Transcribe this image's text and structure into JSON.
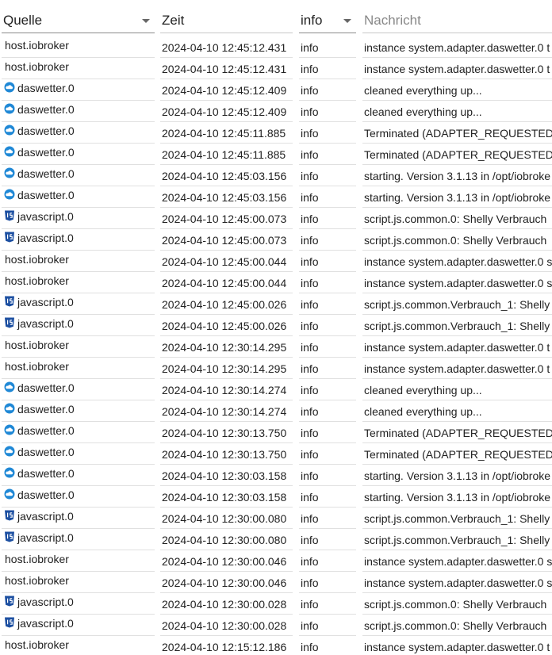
{
  "header": {
    "columns": [
      {
        "label": "Quelle"
      },
      {
        "label": "Zeit"
      },
      {
        "label": "info"
      },
      {
        "label": "Nachricht"
      }
    ]
  },
  "icons": {
    "daswetter": "daswetter-adapter-icon",
    "javascript": "javascript-adapter-icon"
  },
  "colors": {
    "daswetter_icon": "#1f88d6",
    "javascript_icon": "#1c4fa1",
    "row_border": "#e0e0e0",
    "header_border": "#8a8a8a"
  },
  "rows": [
    {
      "type": "host",
      "source": "host.iobroker",
      "time": "2024-04-10 12:45:12.431",
      "level": "info",
      "message": "instance system.adapter.daswetter.0 t"
    },
    {
      "type": "host",
      "source": "host.iobroker",
      "time": "2024-04-10 12:45:12.431",
      "level": "info",
      "message": "instance system.adapter.daswetter.0 t"
    },
    {
      "type": "daswetter",
      "source": "daswetter.0",
      "time": "2024-04-10 12:45:12.409",
      "level": "info",
      "message": "cleaned everything up..."
    },
    {
      "type": "daswetter",
      "source": "daswetter.0",
      "time": "2024-04-10 12:45:12.409",
      "level": "info",
      "message": "cleaned everything up..."
    },
    {
      "type": "daswetter",
      "source": "daswetter.0",
      "time": "2024-04-10 12:45:11.885",
      "level": "info",
      "message": "Terminated (ADAPTER_REQUESTED"
    },
    {
      "type": "daswetter",
      "source": "daswetter.0",
      "time": "2024-04-10 12:45:11.885",
      "level": "info",
      "message": "Terminated (ADAPTER_REQUESTED"
    },
    {
      "type": "daswetter",
      "source": "daswetter.0",
      "time": "2024-04-10 12:45:03.156",
      "level": "info",
      "message": "starting. Version 3.1.13 in /opt/iobroke"
    },
    {
      "type": "daswetter",
      "source": "daswetter.0",
      "time": "2024-04-10 12:45:03.156",
      "level": "info",
      "message": "starting. Version 3.1.13 in /opt/iobroke"
    },
    {
      "type": "javascript",
      "source": "javascript.0",
      "time": "2024-04-10 12:45:00.073",
      "level": "info",
      "message": "script.js.common.0: Shelly Verbrauch"
    },
    {
      "type": "javascript",
      "source": "javascript.0",
      "time": "2024-04-10 12:45:00.073",
      "level": "info",
      "message": "script.js.common.0: Shelly Verbrauch"
    },
    {
      "type": "host",
      "source": "host.iobroker",
      "time": "2024-04-10 12:45:00.044",
      "level": "info",
      "message": "instance system.adapter.daswetter.0 s"
    },
    {
      "type": "host",
      "source": "host.iobroker",
      "time": "2024-04-10 12:45:00.044",
      "level": "info",
      "message": "instance system.adapter.daswetter.0 s"
    },
    {
      "type": "javascript",
      "source": "javascript.0",
      "time": "2024-04-10 12:45:00.026",
      "level": "info",
      "message": "script.js.common.Verbrauch_1: Shelly"
    },
    {
      "type": "javascript",
      "source": "javascript.0",
      "time": "2024-04-10 12:45:00.026",
      "level": "info",
      "message": "script.js.common.Verbrauch_1: Shelly"
    },
    {
      "type": "host",
      "source": "host.iobroker",
      "time": "2024-04-10 12:30:14.295",
      "level": "info",
      "message": "instance system.adapter.daswetter.0 t"
    },
    {
      "type": "host",
      "source": "host.iobroker",
      "time": "2024-04-10 12:30:14.295",
      "level": "info",
      "message": "instance system.adapter.daswetter.0 t"
    },
    {
      "type": "daswetter",
      "source": "daswetter.0",
      "time": "2024-04-10 12:30:14.274",
      "level": "info",
      "message": "cleaned everything up..."
    },
    {
      "type": "daswetter",
      "source": "daswetter.0",
      "time": "2024-04-10 12:30:14.274",
      "level": "info",
      "message": "cleaned everything up..."
    },
    {
      "type": "daswetter",
      "source": "daswetter.0",
      "time": "2024-04-10 12:30:13.750",
      "level": "info",
      "message": "Terminated (ADAPTER_REQUESTED"
    },
    {
      "type": "daswetter",
      "source": "daswetter.0",
      "time": "2024-04-10 12:30:13.750",
      "level": "info",
      "message": "Terminated (ADAPTER_REQUESTED"
    },
    {
      "type": "daswetter",
      "source": "daswetter.0",
      "time": "2024-04-10 12:30:03.158",
      "level": "info",
      "message": "starting. Version 3.1.13 in /opt/iobroke"
    },
    {
      "type": "daswetter",
      "source": "daswetter.0",
      "time": "2024-04-10 12:30:03.158",
      "level": "info",
      "message": "starting. Version 3.1.13 in /opt/iobroke"
    },
    {
      "type": "javascript",
      "source": "javascript.0",
      "time": "2024-04-10 12:30:00.080",
      "level": "info",
      "message": "script.js.common.Verbrauch_1: Shelly"
    },
    {
      "type": "javascript",
      "source": "javascript.0",
      "time": "2024-04-10 12:30:00.080",
      "level": "info",
      "message": "script.js.common.Verbrauch_1: Shelly"
    },
    {
      "type": "host",
      "source": "host.iobroker",
      "time": "2024-04-10 12:30:00.046",
      "level": "info",
      "message": "instance system.adapter.daswetter.0 s"
    },
    {
      "type": "host",
      "source": "host.iobroker",
      "time": "2024-04-10 12:30:00.046",
      "level": "info",
      "message": "instance system.adapter.daswetter.0 s"
    },
    {
      "type": "javascript",
      "source": "javascript.0",
      "time": "2024-04-10 12:30:00.028",
      "level": "info",
      "message": "script.js.common.0: Shelly Verbrauch"
    },
    {
      "type": "javascript",
      "source": "javascript.0",
      "time": "2024-04-10 12:30:00.028",
      "level": "info",
      "message": "script.js.common.0: Shelly Verbrauch"
    },
    {
      "type": "host",
      "source": "host.iobroker",
      "time": "2024-04-10 12:15:12.186",
      "level": "info",
      "message": "instance system.adapter.daswetter.0 t"
    }
  ]
}
